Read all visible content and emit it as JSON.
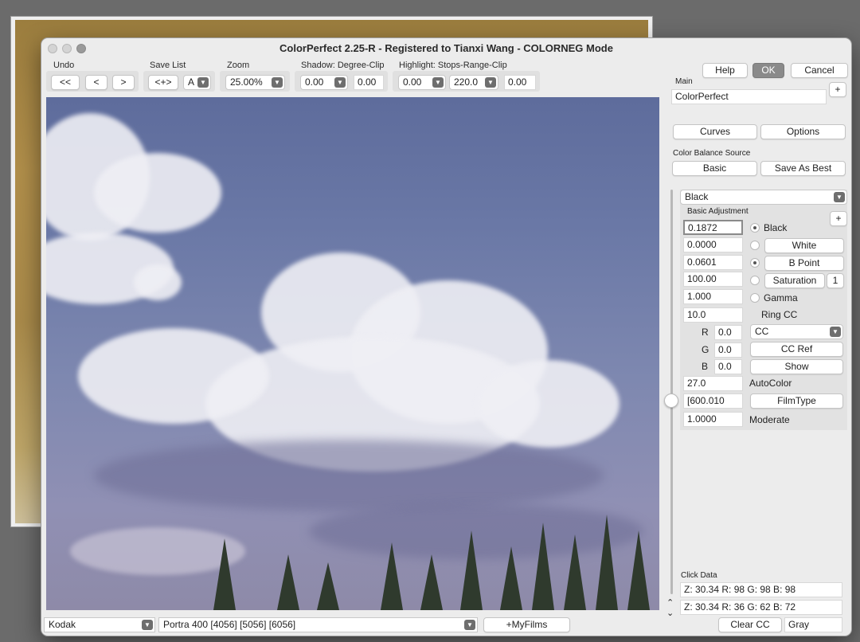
{
  "window": {
    "title": "ColorPerfect 2.25-R - Registered to Tianxi Wang - COLORNEG Mode"
  },
  "toolbar": {
    "undo_label": "Undo",
    "undo_all": "<<",
    "undo_back": "<",
    "undo_forward": ">",
    "savelist_label": "Save List",
    "savelist_button": "<+>",
    "savelist_value": "A",
    "zoom_label": "Zoom",
    "zoom_value": "25.00%",
    "shadow_label": "Shadow: Degree-Clip",
    "shadow_degree": "0.00",
    "shadow_clip": "0.00",
    "highlight_label": "Highlight: Stops-Range-Clip",
    "highlight_stops": "0.00",
    "highlight_range": "220.0",
    "highlight_clip": "0.00"
  },
  "actions": {
    "help": "Help",
    "ok": "OK",
    "cancel": "Cancel"
  },
  "main": {
    "label": "Main",
    "value": "ColorPerfect",
    "add": "+",
    "curves": "Curves",
    "options": "Options",
    "cbs_label": "Color Balance Source",
    "basic": "Basic",
    "save_as_best": "Save As Best"
  },
  "adjust": {
    "mode": "Black",
    "section_label": "Basic Adjustment",
    "add": "+",
    "black_value": "0.1872",
    "black_label": "Black",
    "white_value": "0.0000",
    "white_label": "White",
    "bpoint_value": "0.0601",
    "bpoint_label": "B Point",
    "saturation_value": "100.00",
    "saturation_label": "Saturation",
    "saturation_extra": "1",
    "gamma_value": "1.000",
    "gamma_label": "Gamma",
    "ringcc_value": "10.0",
    "ringcc_label": "Ring CC",
    "r_label": "R",
    "r_value": "0.0",
    "g_label": "G",
    "g_value": "0.0",
    "b_label": "B",
    "b_value": "0.0",
    "cc_select": "CC",
    "cc_ref": "CC Ref",
    "show": "Show",
    "autocolor_value": "27.0",
    "autocolor_label": "AutoColor",
    "filmtype_value": "[600.010",
    "filmtype_label": "FilmType",
    "moderate_value": "1.0000",
    "moderate_label": "Moderate"
  },
  "click_data": {
    "label": "Click Data",
    "row1": "Z:  30.34  R: 98 G: 98 B: 98",
    "row2": "Z:  30.34 R: 36 G: 62 B: 72"
  },
  "bottom": {
    "maker": "Kodak",
    "film": "Portra 400 [4056] [5056] [6056]",
    "myfilms": "+MyFilms",
    "clear_cc": "Clear CC",
    "gray": "Gray"
  }
}
